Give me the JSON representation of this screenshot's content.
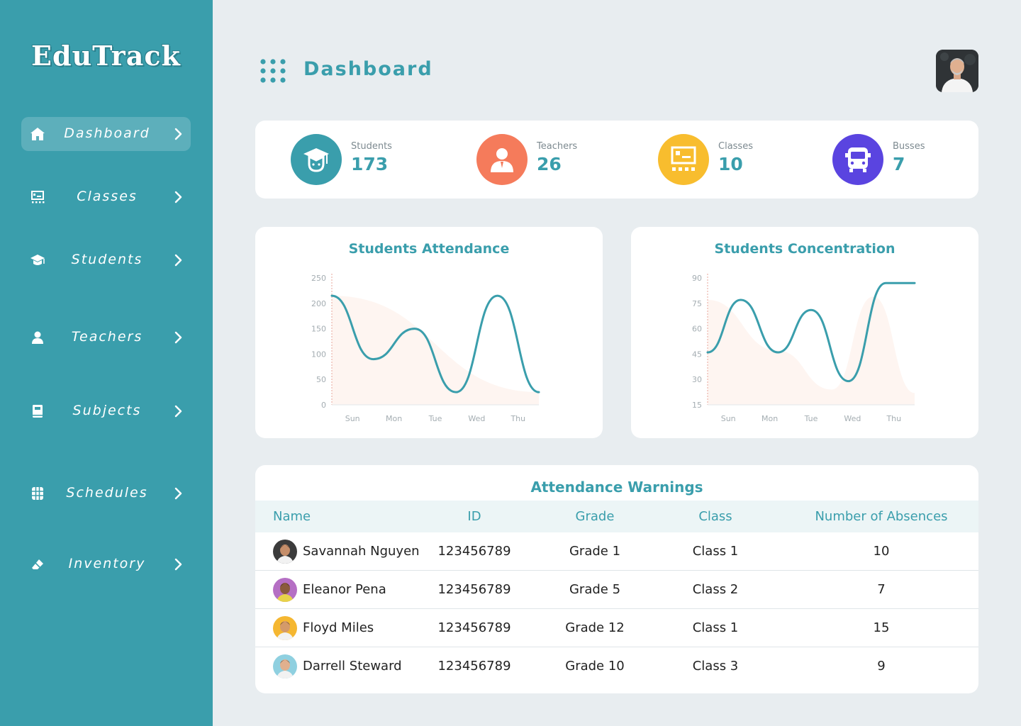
{
  "app": {
    "logo": "EduTrack"
  },
  "colors": {
    "sidebar": "#3a9eac",
    "accent": "#3a9eac",
    "students": "#3a9eac",
    "teachers": "#f57b5b",
    "classes": "#f8bd2e",
    "busses": "#5a44e0"
  },
  "sidebar": {
    "items": [
      {
        "label": "Dashboard",
        "icon": "home-icon",
        "active": true
      },
      {
        "label": "Classes",
        "icon": "classroom-icon"
      },
      {
        "label": "Students",
        "icon": "graduation-cap-icon"
      },
      {
        "label": "Teachers",
        "icon": "person-icon"
      },
      {
        "label": "Subjects",
        "icon": "book-icon"
      },
      {
        "label": "Schedules",
        "icon": "calendar-grid-icon"
      },
      {
        "label": "Inventory",
        "icon": "eraser-icon"
      }
    ]
  },
  "header": {
    "title": "Dashboard",
    "menu_icon": "grid-dots-icon",
    "avatar": "profile-avatar"
  },
  "stats": [
    {
      "label": "Students",
      "value": "173",
      "icon": "graduation-cap-icon"
    },
    {
      "label": "Teachers",
      "value": "26",
      "icon": "person-icon"
    },
    {
      "label": "Classes",
      "value": "10",
      "icon": "classroom-icon"
    },
    {
      "label": "Busses",
      "value": "7",
      "icon": "bus-icon"
    }
  ],
  "chart_data": [
    {
      "type": "line",
      "title": "Students Attendance",
      "categories": [
        "Sun",
        "Mon",
        "Tue",
        "Wed",
        "Thu"
      ],
      "y_ticks": [
        "250",
        "200",
        "150",
        "100",
        "50",
        "0"
      ],
      "ylim": [
        0,
        250
      ],
      "series": [
        {
          "color": "#3a9eac",
          "x": [
            -0.5,
            0.5,
            1.5,
            2.5,
            3.5,
            4.5
          ],
          "values": [
            215,
            90,
            150,
            25,
            215,
            25
          ]
        }
      ],
      "background_area": [
        {
          "color": "#fdf1ec",
          "x": [
            -0.5,
            4.5
          ],
          "values": [
            215,
            25
          ]
        }
      ],
      "grid": false
    },
    {
      "type": "line",
      "title": "Students Concentration",
      "categories": [
        "Sun",
        "Mon",
        "Tue",
        "Wed",
        "Thu"
      ],
      "y_ticks": [
        "90",
        "75",
        "60",
        "45",
        "30",
        "15"
      ],
      "ylim": [
        15,
        90
      ],
      "series": [
        {
          "color": "#3a9eac",
          "x": [
            -0.5,
            0.3,
            1.2,
            2.0,
            2.9,
            3.8,
            4.5
          ],
          "values": [
            46,
            77,
            46,
            71,
            29,
            87,
            87
          ]
        }
      ],
      "background_area": [
        {
          "color": "#fdf1ec",
          "x": [
            -0.5,
            1.2,
            2.5,
            3.5,
            4.5
          ],
          "values": [
            77,
            47,
            24,
            79,
            22
          ]
        }
      ],
      "grid": false
    }
  ],
  "table": {
    "title": "Attendance Warnings",
    "columns": [
      "Name",
      "ID",
      "Grade",
      "Class",
      "Number of Absences"
    ],
    "rows": [
      {
        "name": "Savannah Nguyen",
        "id": "123456789",
        "grade": "Grade 1",
        "class": "Class 1",
        "absences": "10",
        "avatar_bg": "#3b3b3b"
      },
      {
        "name": "Eleanor Pena",
        "id": "123456789",
        "grade": "Grade 5",
        "class": "Class 2",
        "absences": "7",
        "avatar_bg": "#b56fc4"
      },
      {
        "name": "Floyd Miles",
        "id": "123456789",
        "grade": "Grade 12",
        "class": "Class 1",
        "absences": "15",
        "avatar_bg": "#f5b731"
      },
      {
        "name": "Darrell Steward",
        "id": "123456789",
        "grade": "Grade 10",
        "class": "Class 3",
        "absences": "9",
        "avatar_bg": "#8fd0e0"
      }
    ]
  }
}
